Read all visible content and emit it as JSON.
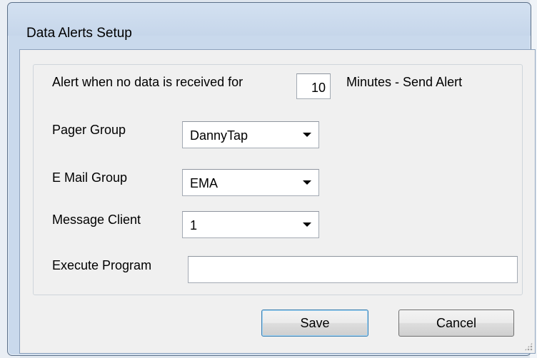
{
  "window": {
    "title": "Data Alerts Setup"
  },
  "alert": {
    "prefix": "Alert when no data is received for",
    "minutes_value": "10",
    "suffix": "Minutes - Send Alert"
  },
  "pager_group": {
    "label": "Pager Group",
    "value": "DannyTap",
    "icon": "chevron-down-icon"
  },
  "email_group": {
    "label": "E Mail Group",
    "value": "EMA",
    "icon": "chevron-down-icon"
  },
  "message_client": {
    "label": "Message Client",
    "value": "1",
    "icon": "chevron-down-icon"
  },
  "execute_program": {
    "label": "Execute Program",
    "value": ""
  },
  "buttons": {
    "save": "Save",
    "cancel": "Cancel"
  }
}
